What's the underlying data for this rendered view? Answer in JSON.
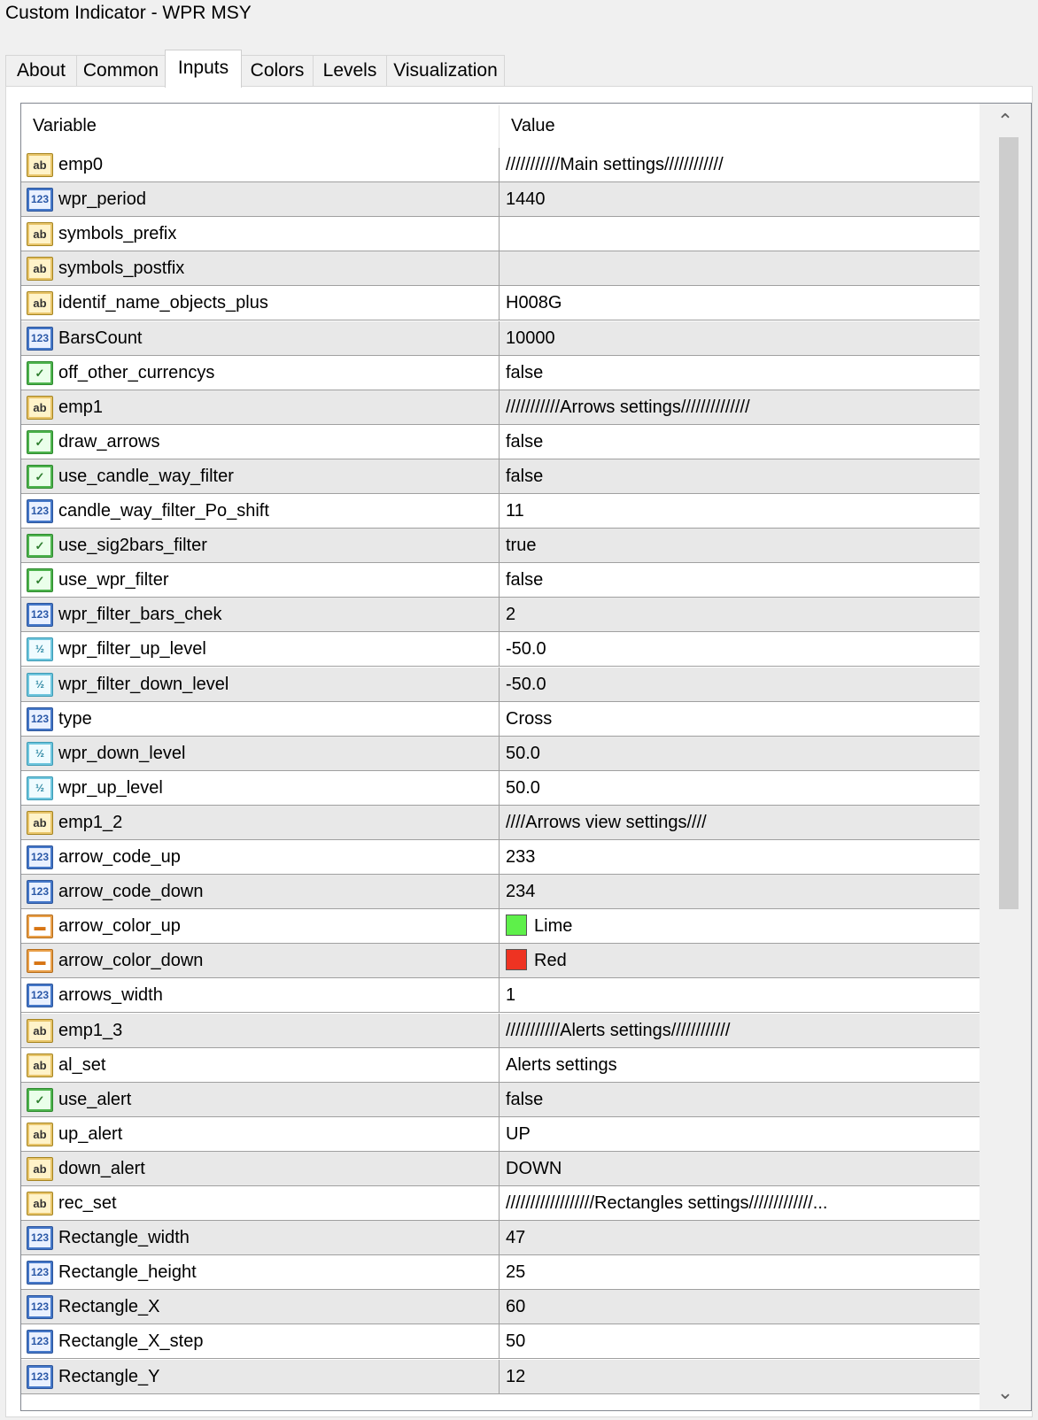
{
  "window": {
    "title": "Custom Indicator - WPR MSY"
  },
  "tabs": [
    {
      "label": "About"
    },
    {
      "label": "Common"
    },
    {
      "label": "Inputs"
    },
    {
      "label": "Colors"
    },
    {
      "label": "Levels"
    },
    {
      "label": "Visualization"
    }
  ],
  "active_tab": "Inputs",
  "grid": {
    "headers": {
      "variable": "Variable",
      "value": "Value"
    },
    "rows": [
      {
        "type": "string",
        "name": "emp0",
        "value": "///////////Main settings////////////"
      },
      {
        "type": "int",
        "name": "wpr_period",
        "value": "1440"
      },
      {
        "type": "string",
        "name": "symbols_prefix",
        "value": ""
      },
      {
        "type": "string",
        "name": "symbols_postfix",
        "value": ""
      },
      {
        "type": "string",
        "name": "identif_name_objects_plus",
        "value": "H008G"
      },
      {
        "type": "int",
        "name": "BarsCount",
        "value": "10000"
      },
      {
        "type": "bool",
        "name": "off_other_currencys",
        "value": "false"
      },
      {
        "type": "string",
        "name": "emp1",
        "value": "///////////Arrows settings//////////////"
      },
      {
        "type": "bool",
        "name": "draw_arrows",
        "value": "false"
      },
      {
        "type": "bool",
        "name": "use_candle_way_filter",
        "value": "false"
      },
      {
        "type": "int",
        "name": "candle_way_filter_Po_shift",
        "value": "11"
      },
      {
        "type": "bool",
        "name": "use_sig2bars_filter",
        "value": "true"
      },
      {
        "type": "bool",
        "name": "use_wpr_filter",
        "value": "false"
      },
      {
        "type": "int",
        "name": "wpr_filter_bars_chek",
        "value": "2"
      },
      {
        "type": "double",
        "name": "wpr_filter_up_level",
        "value": "-50.0"
      },
      {
        "type": "double",
        "name": "wpr_filter_down_level",
        "value": "-50.0"
      },
      {
        "type": "int",
        "name": "type",
        "value": "Cross"
      },
      {
        "type": "double",
        "name": "wpr_down_level",
        "value": "50.0"
      },
      {
        "type": "double",
        "name": "wpr_up_level",
        "value": "50.0"
      },
      {
        "type": "string",
        "name": "emp1_2",
        "value": "////Arrows view settings////"
      },
      {
        "type": "int",
        "name": "arrow_code_up",
        "value": "233"
      },
      {
        "type": "int",
        "name": "arrow_code_down",
        "value": "234"
      },
      {
        "type": "color",
        "name": "arrow_color_up",
        "value": "Lime",
        "swatch": "#5ef04a"
      },
      {
        "type": "color",
        "name": "arrow_color_down",
        "value": "Red",
        "swatch": "#ee3322"
      },
      {
        "type": "int",
        "name": "arrows_width",
        "value": "1"
      },
      {
        "type": "string",
        "name": "emp1_3",
        "value": "///////////Alerts settings////////////"
      },
      {
        "type": "string",
        "name": "al_set",
        "value": "Alerts settings"
      },
      {
        "type": "bool",
        "name": "use_alert",
        "value": "false"
      },
      {
        "type": "string",
        "name": "up_alert",
        "value": "UP"
      },
      {
        "type": "string",
        "name": "down_alert",
        "value": "DOWN"
      },
      {
        "type": "string",
        "name": "rec_set",
        "value": "//////////////////Rectangles settings/////////////..."
      },
      {
        "type": "int",
        "name": "Rectangle_width",
        "value": "47"
      },
      {
        "type": "int",
        "name": "Rectangle_height",
        "value": "25"
      },
      {
        "type": "int",
        "name": "Rectangle_X",
        "value": "60"
      },
      {
        "type": "int",
        "name": "Rectangle_X_step",
        "value": "50"
      },
      {
        "type": "int",
        "name": "Rectangle_Y",
        "value": "12"
      }
    ]
  },
  "icons": {
    "string": {
      "name": "string-type-icon",
      "glyph": "ab"
    },
    "int": {
      "name": "integer-type-icon",
      "glyph": "123"
    },
    "bool": {
      "name": "boolean-type-icon",
      "glyph": "✓"
    },
    "double": {
      "name": "double-type-icon",
      "glyph": "½"
    },
    "color": {
      "name": "color-type-icon",
      "glyph": "▬"
    }
  },
  "scrollbar": {
    "up_glyph": "⌃",
    "down_glyph": "⌄"
  }
}
